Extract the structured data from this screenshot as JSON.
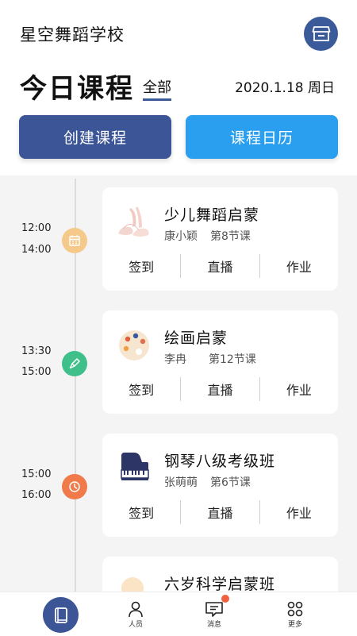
{
  "header": {
    "school_name": "星空舞蹈学校",
    "store_icon": "store-icon"
  },
  "today": {
    "title": "今日课程",
    "filter_label": "全部",
    "date": "2020.1.18 周日"
  },
  "actions": {
    "create_label": "创建课程",
    "calendar_label": "课程日历"
  },
  "courses": [
    {
      "start": "12:00",
      "end": "14:00",
      "icon": "calendar-icon",
      "icon_color": "#f5c98a",
      "title": "少儿舞蹈启蒙",
      "teacher": "康小颖",
      "lesson": "第8节课",
      "thumb": "ballet-shoes-image",
      "actions": [
        "签到",
        "直播",
        "作业"
      ]
    },
    {
      "start": "13:30",
      "end": "15:00",
      "icon": "brush-icon",
      "icon_color": "#3fbf8a",
      "title": "绘画启蒙",
      "teacher": "李冉",
      "lesson": "第12节课",
      "thumb": "palette-image",
      "actions": [
        "签到",
        "直播",
        "作业"
      ]
    },
    {
      "start": "15:00",
      "end": "16:00",
      "icon": "clock-icon",
      "icon_color": "#f07a4a",
      "title": "钢琴八级考级班",
      "teacher": "张萌萌",
      "lesson": "第6节课",
      "thumb": "piano-image",
      "actions": [
        "签到",
        "直播",
        "作业"
      ]
    },
    {
      "title": "六岁科学启蒙班",
      "thumb": "light-bulb-image"
    }
  ],
  "nav": {
    "home_icon": "book-icon",
    "people_label": "人员",
    "messages_label": "消息",
    "more_label": "更多",
    "badge_color": "#f06040"
  }
}
